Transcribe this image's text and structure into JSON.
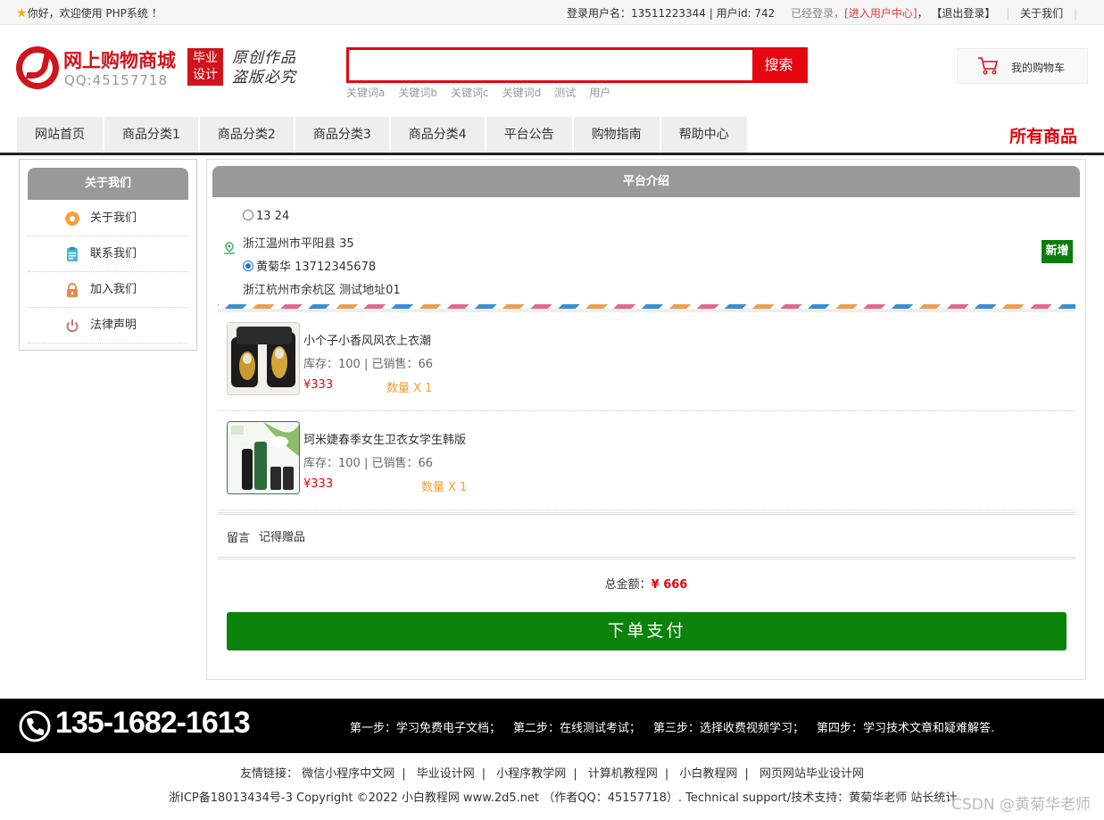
{
  "topbar": {
    "welcome": "你好，欢迎使用 PHP系统 ！",
    "user_info": "登录用户名：13511223344 | 用户id: 742",
    "logged_in": "已经登录，",
    "user_center": "[进入用户中心]",
    "comma": "，",
    "logout": "【退出登录】",
    "about": "关于我们"
  },
  "header": {
    "site_title": "网上购物商城",
    "qq": "QQ:45157718",
    "badge_line1": "毕业",
    "badge_line2": "设计",
    "slogan_line1": "原创作品",
    "slogan_line2": "盗版必究",
    "search": {
      "value": "",
      "button": "搜索"
    },
    "hot_keywords": [
      "关键词a",
      "关键词b",
      "关键词c",
      "关键词d",
      "测试",
      "用户"
    ],
    "cart_label": "我的购物车"
  },
  "nav": {
    "items": [
      "网站首页",
      "商品分类1",
      "商品分类2",
      "商品分类3",
      "商品分类4",
      "平台公告",
      "购物指南",
      "帮助中心"
    ],
    "all_goods": "所有商品"
  },
  "sidebar": {
    "title": "关于我们",
    "items": [
      {
        "label": "关于我们",
        "icon": "orange-circle-icon",
        "color": "#f6a13a"
      },
      {
        "label": "联系我们",
        "icon": "clipboard-icon",
        "color": "#4fb8d8"
      },
      {
        "label": "加入我们",
        "icon": "lock-icon",
        "color": "#e58b4b"
      },
      {
        "label": "法律声明",
        "icon": "power-icon",
        "color": "#c77a6a"
      }
    ]
  },
  "main": {
    "title": "平台介绍",
    "addresses": [
      {
        "name_phone": "13 24",
        "address": "浙江温州市平阳县 35",
        "selected": false
      },
      {
        "name_phone": "黄菊华 13712345678",
        "address": "浙江杭州市余杭区 测试地址01",
        "selected": true
      }
    ],
    "add_button": "新增",
    "products": [
      {
        "name": "小个子小香风风衣上衣潮",
        "stock": "库存：100 | 已销售：66",
        "price": "¥333",
        "qty": "数量 X 1"
      },
      {
        "name": "珂米婕春季女生卫衣女学生韩版",
        "stock": "库存：100 | 已销售：66",
        "price": "¥333",
        "qty": "数量 X 1"
      }
    ],
    "message_label": "留言",
    "message_value": "记得赠品",
    "total_label": "总金额：",
    "total_value": "¥ 666",
    "pay_button": "下单支付"
  },
  "footer": {
    "phone": "135-1682-1613",
    "steps": [
      "第一步：学习免费电子文档；",
      "第二步：在线测试考试；",
      "第三步：选择收费视频学习；",
      "第四步：学习技术文章和疑难解答."
    ],
    "links_label": "友情链接：",
    "links": [
      "微信小程序中文网",
      "毕业设计网",
      "小程序教学网",
      "计算机教程网",
      "小白教程网",
      "网页网站毕业设计网"
    ],
    "copyright": "浙ICP备18013434号-3 Copyright ©2022 小白教程网 www.2d5.net （作者QQ：45157718）. Technical support/技术支持：黄菊华老师 站长统计",
    "watermark": "CSDN @黄菊华老师"
  },
  "colors": {
    "accent_red": "#e4050e",
    "pay_green": "#0b830b",
    "header_gray": "#999999"
  }
}
